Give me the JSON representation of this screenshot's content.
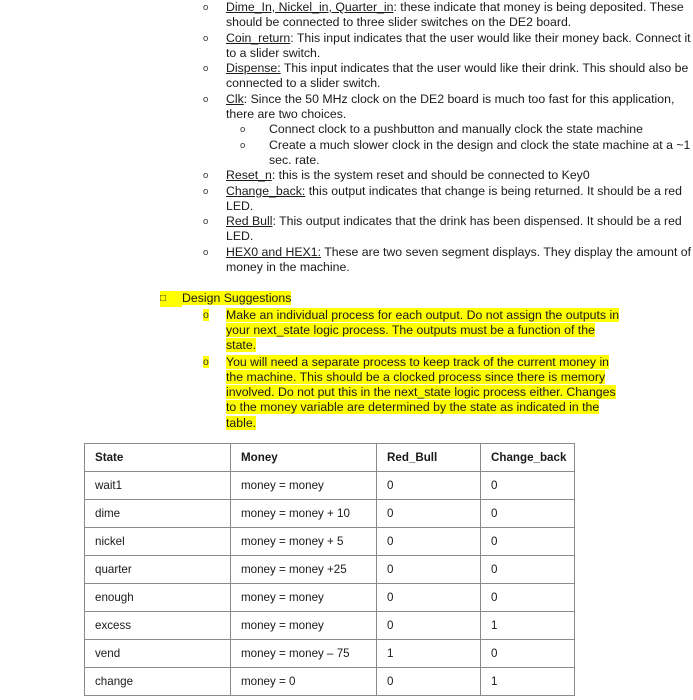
{
  "document": {
    "ports": [
      {
        "term": "Dime_In, Nickel_in, Quarter_in",
        "term_suffix": ":",
        "text": " these indicate that money is being deposited. These should be connected to three slider switches on the DE2 board."
      },
      {
        "term": "Coin_return",
        "term_suffix": ":",
        "text": " This input indicates that the user would like their money back. Connect it to a slider switch."
      },
      {
        "term": "Dispense:",
        "term_suffix": "",
        "text": " This input indicates that the user would like their drink. This should also be connected to a slider switch."
      },
      {
        "term": "Clk",
        "term_suffix": ":",
        "text": " Since the 50 MHz clock on the DE2 board is much too fast for this application, there are two choices."
      }
    ],
    "clk_choices": [
      "Connect clock to a pushbutton and manually clock the state machine",
      "Create a much slower clock in the design and clock the state machine at a ~1 sec. rate."
    ],
    "ports_continued": [
      {
        "term": "Reset_n",
        "term_suffix": ":",
        "text": " this is the system reset and should be connected to Key0"
      },
      {
        "term": "Change_back:",
        "term_suffix": "",
        "text": " this output indicates that change is being returned. It should be a red LED."
      },
      {
        "term": "Red Bull",
        "term_suffix": ":",
        "text": " This output indicates that the drink has been dispensed. It should be a red LED."
      },
      {
        "term": "HEX0 and HEX1:",
        "term_suffix": "",
        "text": " These are two seven segment displays. They display the amount of money in the machine."
      }
    ],
    "suggestions": {
      "heading": "Design Suggestions",
      "heading_marker": "□",
      "items": [
        "Make an individual process for each output. Do not assign the outputs in your next_state logic process. The outputs must be a function of the state.",
        "You will need a separate process to keep track of the current money in the machine. This should be a clocked process since there is memory involved. Do not put this in the next_state logic process either. Changes to the money variable are determined by the state as indicated in the table."
      ]
    },
    "bullet_marker": "o",
    "highlight_color": "#ffff00"
  },
  "table": {
    "headers": [
      "State",
      "Money",
      "Red_Bull",
      "Change_back"
    ],
    "rows": [
      {
        "state": "wait1",
        "money": "money = money",
        "red_bull": "0",
        "change_back": "0"
      },
      {
        "state": "dime",
        "money": "money = money + 10",
        "red_bull": "0",
        "change_back": "0"
      },
      {
        "state": "nickel",
        "money": "money = money + 5",
        "red_bull": "0",
        "change_back": "0"
      },
      {
        "state": "quarter",
        "money": "money = money +25",
        "red_bull": "0",
        "change_back": "0"
      },
      {
        "state": "enough",
        "money": "money = money",
        "red_bull": "0",
        "change_back": "0"
      },
      {
        "state": "excess",
        "money": "money = money",
        "red_bull": "0",
        "change_back": "1"
      },
      {
        "state": "vend",
        "money": "money = money – 75",
        "red_bull": "1",
        "change_back": "0"
      },
      {
        "state": "change",
        "money": "money = 0",
        "red_bull": "0",
        "change_back": "1"
      }
    ]
  }
}
